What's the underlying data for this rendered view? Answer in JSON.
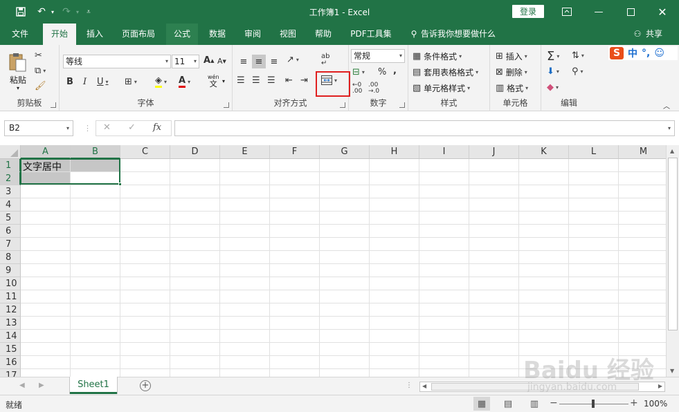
{
  "title_bar": {
    "title": "工作簿1  -  Excel",
    "login": "登录",
    "icons": [
      "save-icon",
      "undo-icon",
      "redo-icon",
      "customize-qat-icon",
      "ribbon-display-icon",
      "minimize-icon",
      "maximize-icon",
      "close-icon"
    ]
  },
  "tabs": [
    {
      "label": "文件"
    },
    {
      "label": "开始"
    },
    {
      "label": "插入"
    },
    {
      "label": "页面布局"
    },
    {
      "label": "公式"
    },
    {
      "label": "数据"
    },
    {
      "label": "审阅"
    },
    {
      "label": "视图"
    },
    {
      "label": "帮助"
    },
    {
      "label": "PDF工具集"
    },
    {
      "label": "告诉我你想要做什么"
    }
  ],
  "share": "共享",
  "ribbon": {
    "clipboard": {
      "paste": "粘贴",
      "label": "剪贴板"
    },
    "font": {
      "font_name": "等线",
      "font_size": "11",
      "wen": "wén",
      "wen_char": "文",
      "label": "字体"
    },
    "alignment": {
      "label": "对齐方式"
    },
    "number": {
      "format": "常规",
      "percent": "%",
      "comma": ",",
      "label": "数字"
    },
    "styles": {
      "conditional": "条件格式",
      "table": "套用表格格式",
      "cell_styles": "单元格样式",
      "label": "样式"
    },
    "cells": {
      "insert": "插入",
      "delete": "删除",
      "format": "格式",
      "label": "单元格"
    },
    "editing": {
      "label": "编辑"
    }
  },
  "ime": {
    "logo": "S",
    "mode": "中",
    "punct": "°,"
  },
  "formula_bar": {
    "name_box": "B2",
    "fx": "fx",
    "value": ""
  },
  "grid": {
    "columns": [
      "A",
      "B",
      "C",
      "D",
      "E",
      "F",
      "G",
      "H",
      "I",
      "J",
      "K",
      "L",
      "M"
    ],
    "rows": [
      "1",
      "2",
      "3",
      "4",
      "5",
      "6",
      "7",
      "8",
      "9",
      "10",
      "11",
      "12",
      "13",
      "14",
      "15",
      "16",
      "17"
    ],
    "cells": {
      "A1": "文字居中"
    },
    "selected": "A1:B2",
    "active_cell": "B2"
  },
  "sheets": [
    {
      "name": "Sheet1",
      "active": true
    }
  ],
  "status": {
    "ready": "就绪",
    "zoom": "100%"
  },
  "watermark": {
    "main": "Baidu 经验",
    "sub": "jingyan.baidu.com"
  }
}
